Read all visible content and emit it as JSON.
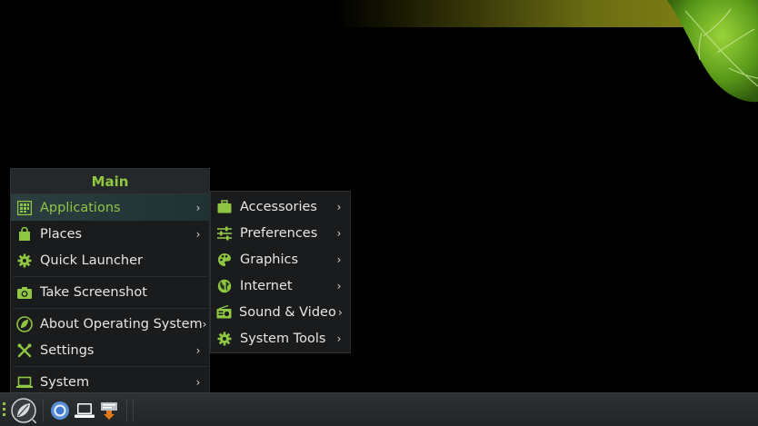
{
  "colors": {
    "accent": "#8fc642",
    "menu_bg": "#191b1c",
    "panel_bg": "#25282a",
    "text": "#e6e6e6"
  },
  "main_menu": {
    "title": "Main",
    "items": [
      {
        "label": "Applications",
        "icon": "apps-grid-icon",
        "submenu": true,
        "active": true
      },
      {
        "label": "Places",
        "icon": "shopping-bag-icon",
        "submenu": true
      },
      {
        "label": "Quick Launcher",
        "icon": "gear-icon",
        "submenu": false
      },
      {
        "label": "Take Screenshot",
        "icon": "camera-icon",
        "submenu": false
      },
      {
        "label": "About Operating System",
        "icon": "leaf-logo-icon",
        "submenu": true
      },
      {
        "label": "Settings",
        "icon": "tools-icon",
        "submenu": true
      },
      {
        "label": "System",
        "icon": "laptop-icon",
        "submenu": true
      }
    ]
  },
  "submenu": {
    "items": [
      {
        "label": "Accessories",
        "icon": "briefcase-icon"
      },
      {
        "label": "Preferences",
        "icon": "sliders-icon"
      },
      {
        "label": "Graphics",
        "icon": "palette-icon"
      },
      {
        "label": "Internet",
        "icon": "globe-icon"
      },
      {
        "label": "Sound & Video",
        "icon": "radio-icon"
      },
      {
        "label": "System Tools",
        "icon": "gear-icon"
      }
    ]
  },
  "taskbar": {
    "items": [
      "menu-leaf-icon",
      "chromium-browser-icon",
      "laptop-icon",
      "file-manager-icon"
    ]
  }
}
